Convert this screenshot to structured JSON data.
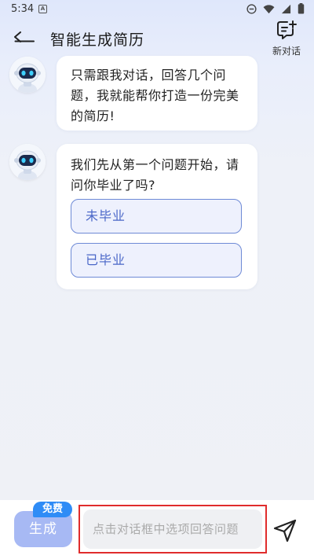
{
  "status_bar": {
    "time": "5:34",
    "notification_badge": "A"
  },
  "header": {
    "title": "智能生成简历",
    "new_chat_label": "新对话"
  },
  "messages": [
    {
      "text": "只需跟我对话，回答几个问题，我就能帮你打造一份完美的简历!"
    },
    {
      "text": "我们先从第一个问题开始，请问你毕业了吗?",
      "options": [
        "未毕业",
        "已毕业"
      ]
    }
  ],
  "bottom": {
    "generate_label": "生成",
    "free_badge": "免费",
    "input_placeholder": "点击对话框中选项回答问题"
  },
  "icons": [
    "back-arrow-icon",
    "new-chat-icon",
    "robot-avatar-icon",
    "send-icon",
    "dnd-icon",
    "wifi-icon",
    "signal-icon",
    "battery-icon"
  ],
  "colors": {
    "accent": "#4a67c8",
    "option_border": "#6e8ad6",
    "generate_bg": "#a7b9f4",
    "free_badge_bg": "#2f8cf6",
    "highlight_border": "#e02c2c"
  }
}
